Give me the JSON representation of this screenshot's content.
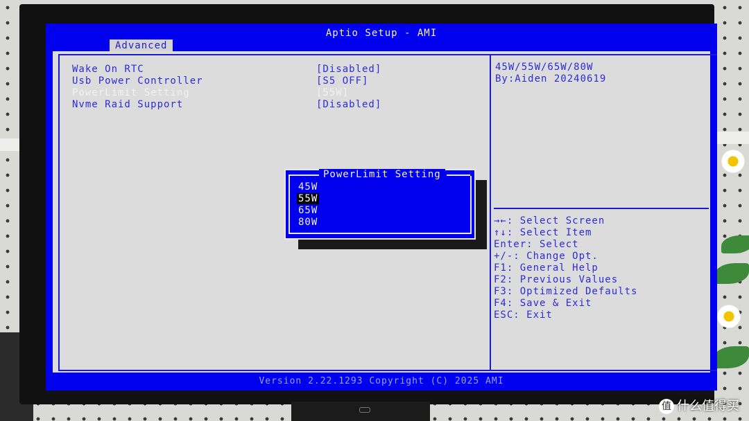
{
  "bios": {
    "title": "Aptio Setup - AMI",
    "tab_advanced": "Advanced",
    "settings": [
      {
        "label": "Wake On RTC",
        "value": "[Disabled]"
      },
      {
        "label": "Usb Power Controller",
        "value": "[S5 OFF]"
      },
      {
        "label": "PowerLimit Setting",
        "value": "[55W]"
      },
      {
        "label": "Nvme Raid Support",
        "value": "[Disabled]"
      }
    ],
    "help_text": [
      "45W/55W/65W/80W",
      "By:Aiden 20240619"
    ],
    "key_help": [
      "→←: Select Screen",
      "↑↓: Select Item",
      "Enter: Select",
      "+/-: Change Opt.",
      "F1: General Help",
      "F2: Previous Values",
      "F3: Optimized Defaults",
      "F4: Save & Exit",
      "ESC: Exit"
    ],
    "footer": "Version 2.22.1293 Copyright (C) 2025 AMI",
    "popup": {
      "title": "PowerLimit Setting",
      "options": [
        "45W",
        "55W",
        "65W",
        "80W"
      ],
      "selected": "55W"
    },
    "colors": {
      "bios_blue": "#0000ee",
      "panel_gray": "#dcdcdc",
      "text_blue": "#2b2bdc"
    }
  },
  "watermark": {
    "icon": "值",
    "text": "什么值得买"
  }
}
